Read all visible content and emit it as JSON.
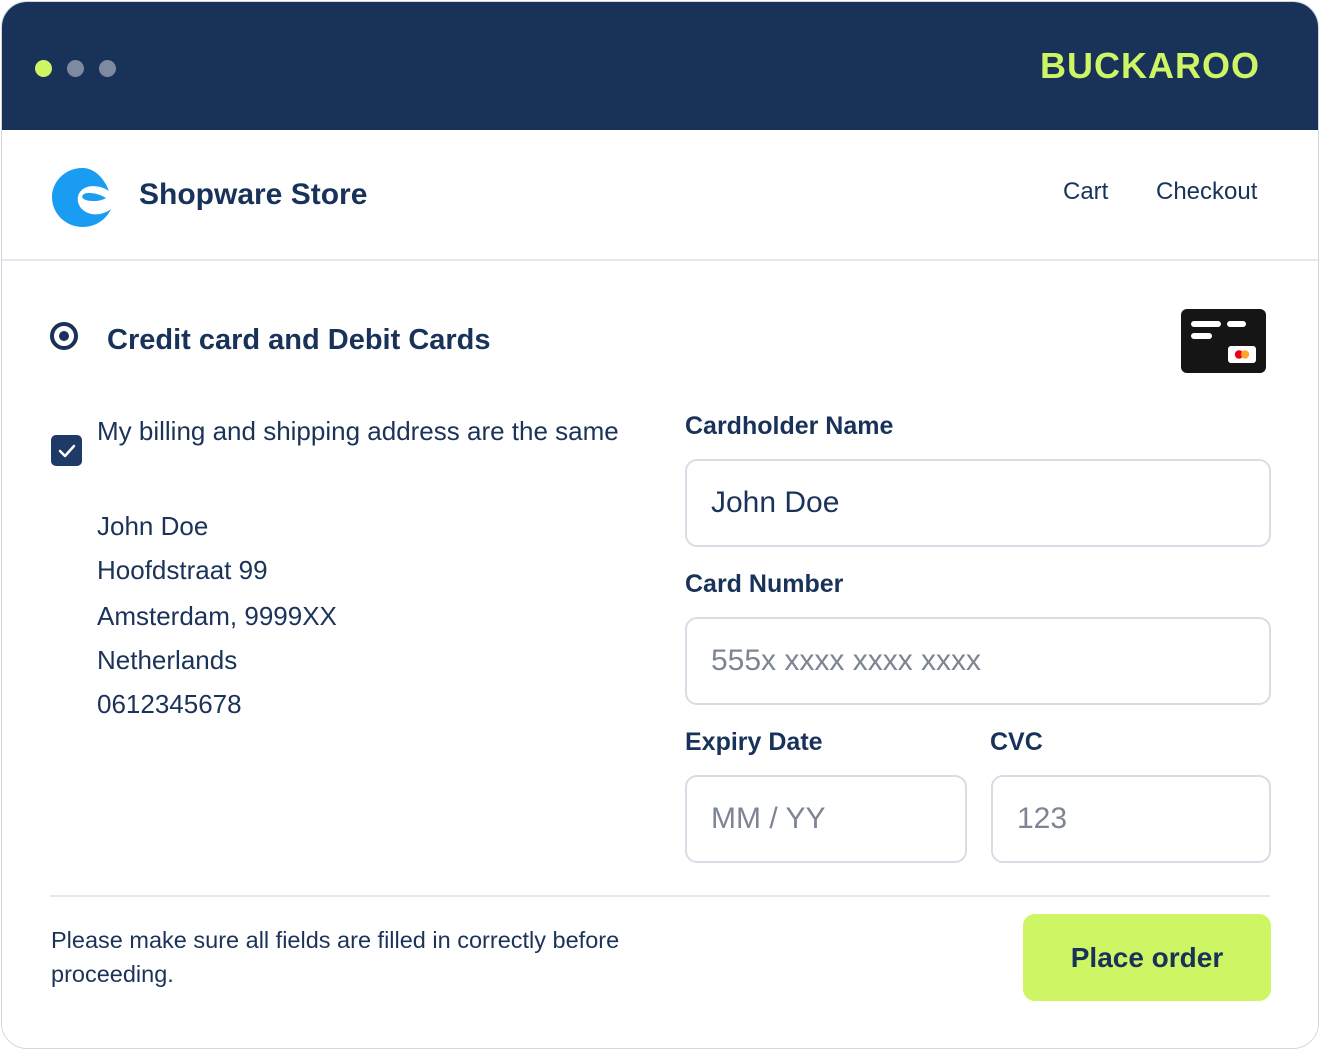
{
  "window": {
    "brand_name": "BUCKAROO",
    "colors": {
      "titlebar": "#183259",
      "accent": "#cdf564",
      "dot_inactive": "#7d8aa0"
    }
  },
  "header": {
    "store_name": "Shopware Store",
    "logo_icon": "shopware-logo-icon",
    "nav": {
      "cart_label": "Cart",
      "checkout_label": "Checkout"
    }
  },
  "payment": {
    "method_label": "Credit card and Debit Cards",
    "method_selected": true,
    "card_icon": "credit-card-icon",
    "same_address_checked": true,
    "same_address_label": "My billing and shipping address are the same",
    "address": {
      "name": "John Doe",
      "street": "Hoofdstraat 99",
      "city": "Amsterdam, 9999XX",
      "country": "Netherlands",
      "phone": "0612345678"
    },
    "form": {
      "cardholder_label": "Cardholder Name",
      "cardholder_value": "John Doe",
      "card_number_label": "Card Number",
      "card_number_placeholder": "555x xxxx xxxx xxxx",
      "expiry_label": "Expiry Date",
      "expiry_placeholder": "MM / YY",
      "cvc_label": "CVC",
      "cvc_placeholder": "123"
    }
  },
  "footer": {
    "notice": "Please make sure all fields are filled in correctly before proceeding.",
    "place_order_label": "Place order"
  }
}
